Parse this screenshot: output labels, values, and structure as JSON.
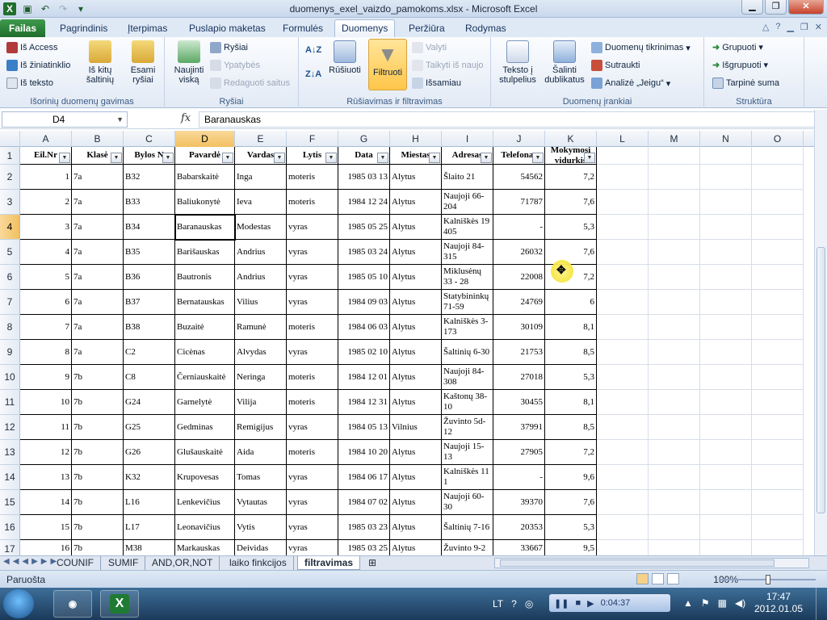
{
  "window": {
    "title": "duomenys_exel_vaizdo_pamokoms.xlsx - Microsoft Excel",
    "minimize": "▁",
    "restore": "❐",
    "close": "✕"
  },
  "tabs": [
    "Failas",
    "Pagrindinis",
    "Įterpimas",
    "Puslapio maketas",
    "Formulės",
    "Duomenys",
    "Peržiūra",
    "Rodymas"
  ],
  "active_tab": "Duomenys",
  "ribbon": {
    "group1": {
      "label": "Išorinių duomenų gavimas",
      "from_access": "Iš Access",
      "from_web": "Iš žiniatinklio",
      "from_text": "Iš teksto",
      "from_other": "Iš kitų šaltinių",
      "existing": "Esami ryšiai"
    },
    "group2": {
      "label": "Ryšiai",
      "refresh_all": "Naujinti viską",
      "connections": "Ryšiai",
      "properties": "Ypatybės",
      "edit_links": "Redaguoti saitus"
    },
    "group3": {
      "label": "Rūšiavimas ir filtravimas",
      "sort": "Rūšiuoti",
      "filter": "Filtruoti",
      "clear": "Valyti",
      "reapply": "Taikyti iš naujo",
      "advanced": "Išsamiau"
    },
    "group4": {
      "label": "Duomenų įrankiai",
      "text_to_columns": "Teksto į stulpelius",
      "remove_duplicates": "Šalinti dublikatus",
      "validation": "Duomenų tikrinimas",
      "consolidate": "Sutraukti",
      "whatif": "Analizė „Jeigu“"
    },
    "group5": {
      "label": "Struktūra",
      "group": "Grupuoti",
      "ungroup": "Išgrupuoti",
      "subtotal": "Tarpinė suma"
    }
  },
  "formula_bar": {
    "name_box": "D4",
    "fx": "fx",
    "value": "Baranauskas"
  },
  "columns": [
    "A",
    "B",
    "C",
    "D",
    "E",
    "F",
    "G",
    "H",
    "I",
    "J",
    "K",
    "L",
    "M",
    "N",
    "O"
  ],
  "row_numbers": [
    "1",
    "2",
    "3",
    "4",
    "5",
    "6",
    "7",
    "8",
    "9",
    "10",
    "11",
    "12",
    "13",
    "14",
    "15",
    "16",
    "17"
  ],
  "table": {
    "headers": [
      "Eil.Nr",
      "Klasė",
      "Bylos N",
      "Pavardė",
      "Vardas",
      "Lytis",
      "Data",
      "Miestas",
      "Adresas",
      "Telefonas",
      "Mokymosi vidurkis"
    ],
    "rows": [
      [
        "1",
        "7a",
        "B32",
        "Babarskaitė",
        "Inga",
        "moteris",
        "1985 03 13",
        "Alytus",
        "Šlaito 21",
        "54562",
        "7,2"
      ],
      [
        "2",
        "7a",
        "B33",
        "Baliukonytė",
        "Ieva",
        "moteris",
        "1984 12 24",
        "Alytus",
        "Naujoji 66-204",
        "71787",
        "7,6"
      ],
      [
        "3",
        "7a",
        "B34",
        "Baranauskas",
        "Modestas",
        "vyras",
        "1985 05 25",
        "Alytus",
        "Kalniškės 19 405",
        "-",
        "5,3"
      ],
      [
        "4",
        "7a",
        "B35",
        "Barišauskas",
        "Andrius",
        "vyras",
        "1985 03 24",
        "Alytus",
        "Naujoji 84-315",
        "26032",
        "7,6"
      ],
      [
        "5",
        "7a",
        "B36",
        "Bautronis",
        "Andrius",
        "vyras",
        "1985 05 10",
        "Alytus",
        "Miklusėnų 33 - 28",
        "22008",
        "7,2"
      ],
      [
        "6",
        "7a",
        "B37",
        "Bernatauskas",
        "Vilius",
        "vyras",
        "1984 09 03",
        "Alytus",
        "Statybininkų 71-59",
        "24769",
        "6"
      ],
      [
        "7",
        "7a",
        "B38",
        "Buzaitė",
        "Ramunė",
        "moteris",
        "1984 06 03",
        "Alytus",
        "Kalniškės 3-173",
        "30109",
        "8,1"
      ],
      [
        "8",
        "7a",
        "C2",
        "Cicėnas",
        "Alvydas",
        "vyras",
        "1985 02 10",
        "Alytus",
        "Šaltinių 6-30",
        "21753",
        "8,5"
      ],
      [
        "9",
        "7b",
        "C8",
        "Černiauskaitė",
        "Neringa",
        "moteris",
        "1984 12 01",
        "Alytus",
        "Naujoji 84-308",
        "27018",
        "5,3"
      ],
      [
        "10",
        "7b",
        "G24",
        "Garnelytė",
        "Vilija",
        "moteris",
        "1984 12 31",
        "Alytus",
        "Kaštonų 38-10",
        "30455",
        "8,1"
      ],
      [
        "11",
        "7b",
        "G25",
        "Gedminas",
        "Remigijus",
        "vyras",
        "1984 05 13",
        "Vilnius",
        "Žuvinto 5d-12",
        "37991",
        "8,5"
      ],
      [
        "12",
        "7b",
        "G26",
        "Glušauskaitė",
        "Aida",
        "moteris",
        "1984 10 20",
        "Alytus",
        "Naujoji 15-13",
        "27905",
        "7,2"
      ],
      [
        "13",
        "7b",
        "K32",
        "Krupovesas",
        "Tomas",
        "vyras",
        "1984 06 17",
        "Alytus",
        "Kalniškės 11 1",
        "-",
        "9,6"
      ],
      [
        "14",
        "7b",
        "L16",
        "Lenkevičius",
        "Vytautas",
        "vyras",
        "1984 07 02",
        "Alytus",
        "Naujoji 60-30",
        "39370",
        "7,6"
      ],
      [
        "15",
        "7b",
        "L17",
        "Leonavičius",
        "Vytis",
        "vyras",
        "1985 03 23",
        "Alytus",
        "Šaltinių 7-16",
        "20353",
        "5,3"
      ],
      [
        "16",
        "7b",
        "M38",
        "Markauskas",
        "Deividas",
        "vyras",
        "1985 03 25",
        "Alytus",
        "Žuvinto 9-2",
        "33667",
        "9,5"
      ]
    ]
  },
  "sheet_tabs": [
    "COUNIF",
    "SUMIF",
    "AND,OR,NOT",
    "laiko finkcijos",
    "filtravimas"
  ],
  "active_sheet": "filtravimas",
  "status": {
    "ready": "Paruošta",
    "zoom": "100%"
  },
  "taskbar": {
    "lang": "LT",
    "player_time": "0:04:37",
    "time": "17:47",
    "date": "2012.01.05"
  },
  "colors": {
    "accent": "#1f6e2c",
    "ribbon_bg": "#dfe9f5",
    "selection": "#f2c060"
  }
}
